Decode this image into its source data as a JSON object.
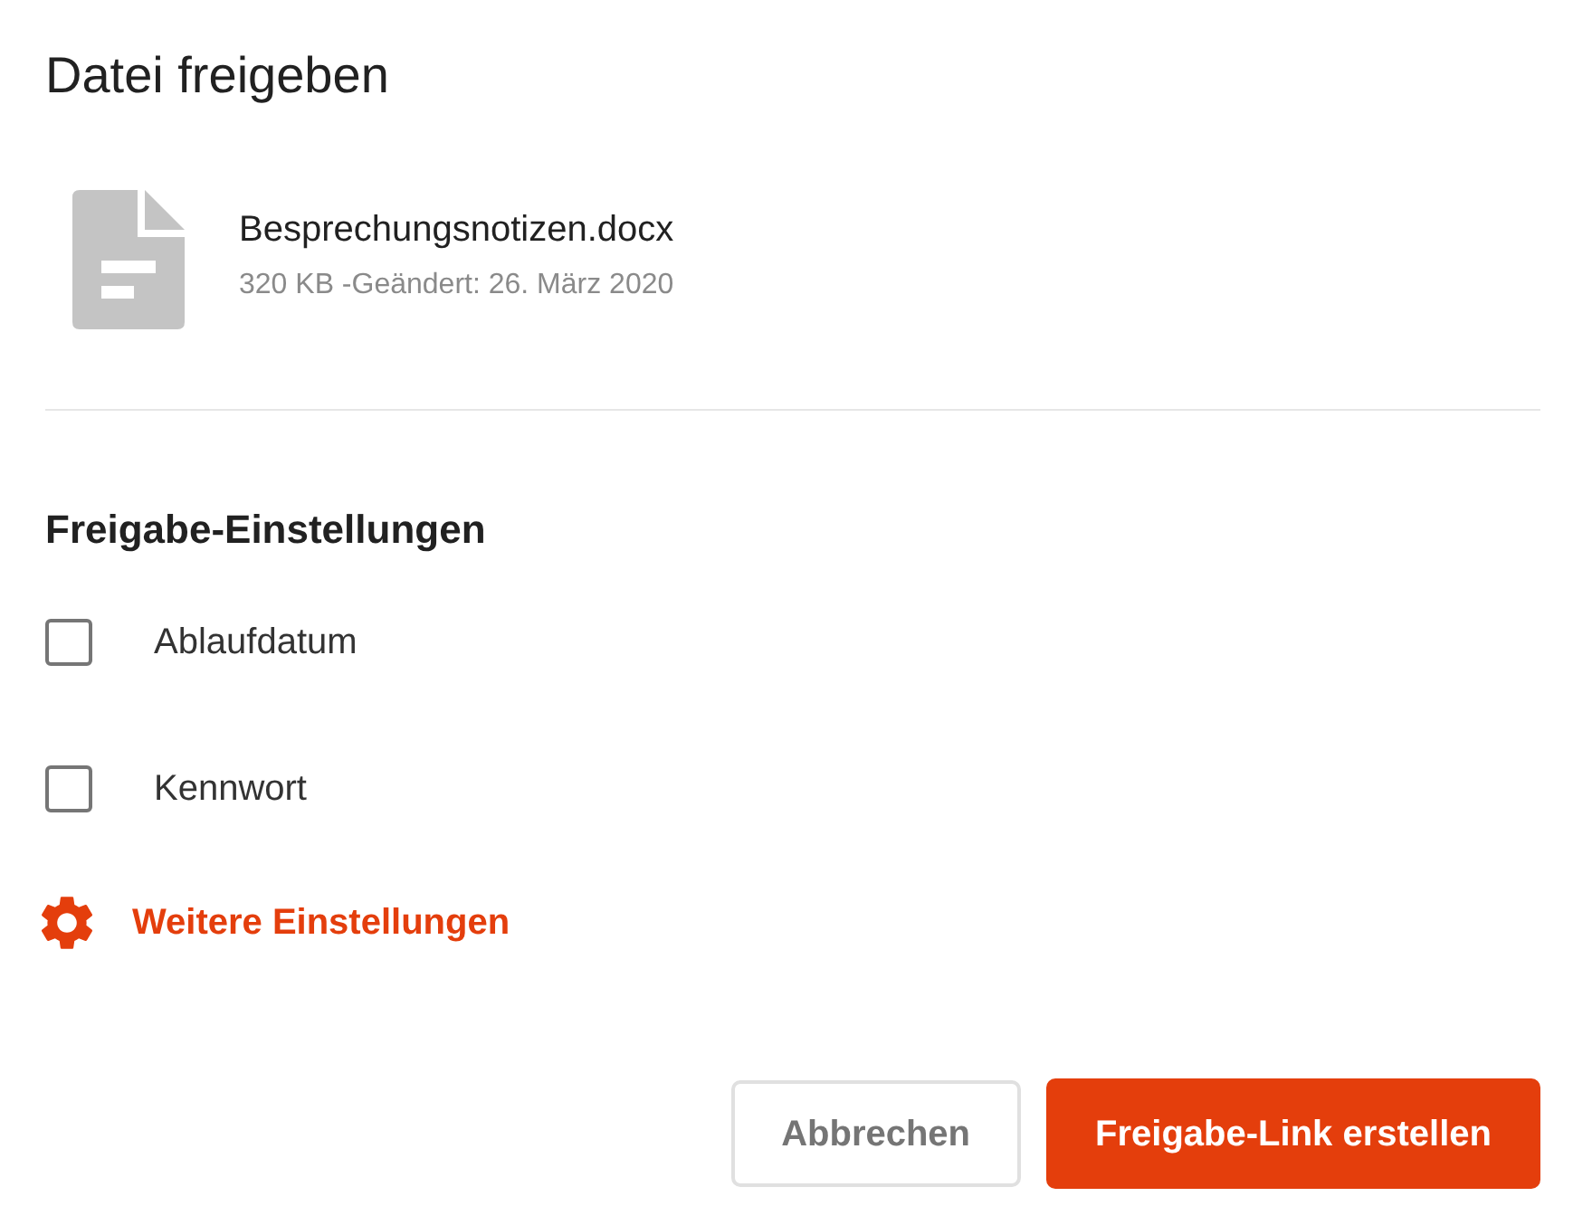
{
  "dialog": {
    "title": "Datei freigeben"
  },
  "file": {
    "name": "Besprechungsnotizen.docx",
    "meta": "320 KB -Geändert: 26. März 2020"
  },
  "settings": {
    "heading": "Freigabe-Einstellungen",
    "options": [
      {
        "label": "Ablaufdatum",
        "checked": false
      },
      {
        "label": "Kennwort",
        "checked": false
      }
    ],
    "more_link": "Weitere Einstellungen"
  },
  "buttons": [
    {
      "label": "Abbrechen",
      "kind": "secondary"
    },
    {
      "label": "Freigabe-Link erstellen",
      "kind": "primary"
    }
  ]
}
